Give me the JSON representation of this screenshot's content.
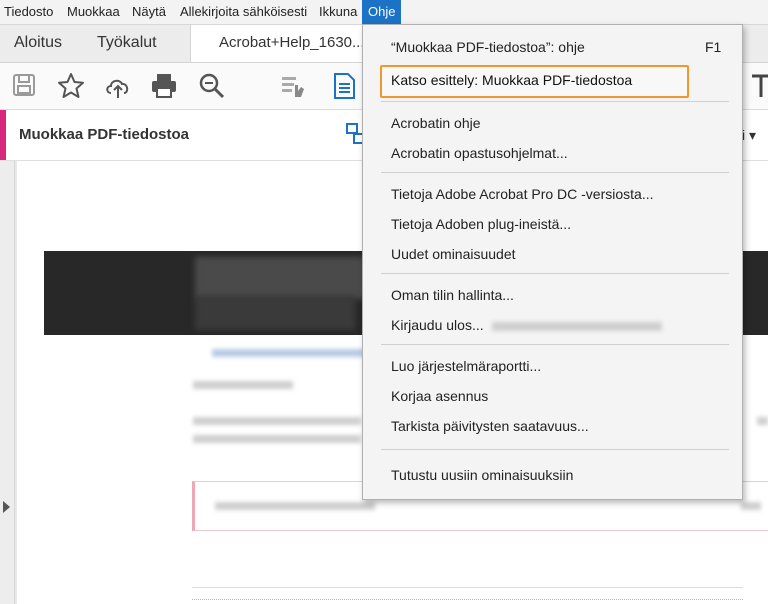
{
  "menubar": {
    "items": [
      {
        "label": "Tiedosto"
      },
      {
        "label": "Muokkaa"
      },
      {
        "label": "Näytä"
      },
      {
        "label": "Allekirjoita sähköisesti"
      },
      {
        "label": "Ikkuna"
      },
      {
        "label": "Ohje"
      }
    ]
  },
  "tabs": {
    "home": "Aloitus",
    "tools": "Työkalut",
    "document": "Acrobat+Help_1630..."
  },
  "toolbar": {
    "icons": [
      "save-icon",
      "bookmark-star-icon",
      "cloud-upload-icon",
      "print-icon",
      "zoom-search-icon",
      "hand-tool-icon",
      "document-icon"
    ]
  },
  "toolstrip": {
    "title": "Muokkaa PDF-tiedostoa",
    "right_label": "ki"
  },
  "help_menu": {
    "items": [
      {
        "label": "“Muokkaa PDF-tiedostoa”: ohje",
        "shortcut": "F1"
      },
      {
        "label": "Katso esittely: Muokkaa PDF-tiedostoa"
      },
      {
        "label": "Acrobatin ohje"
      },
      {
        "label": "Acrobatin opastusohjelmat..."
      },
      {
        "label": "Tietoja Adobe Acrobat Pro DC -versiosta..."
      },
      {
        "label": "Tietoja Adoben plug-ineistä..."
      },
      {
        "label": "Uudet ominaisuudet"
      },
      {
        "label": "Oman tilin hallinta..."
      },
      {
        "label": "Kirjaudu ulos..."
      },
      {
        "label": "Luo järjestelmäraportti..."
      },
      {
        "label": "Korjaa asennus"
      },
      {
        "label": "Tarkista päivitysten saatavuus..."
      },
      {
        "label": "Tutustu uusiin ominaisuuksiin"
      }
    ]
  },
  "colors": {
    "menu_active": "#1c72c4",
    "highlight_border": "#f0982d",
    "tool_accent": "#d6287f"
  }
}
